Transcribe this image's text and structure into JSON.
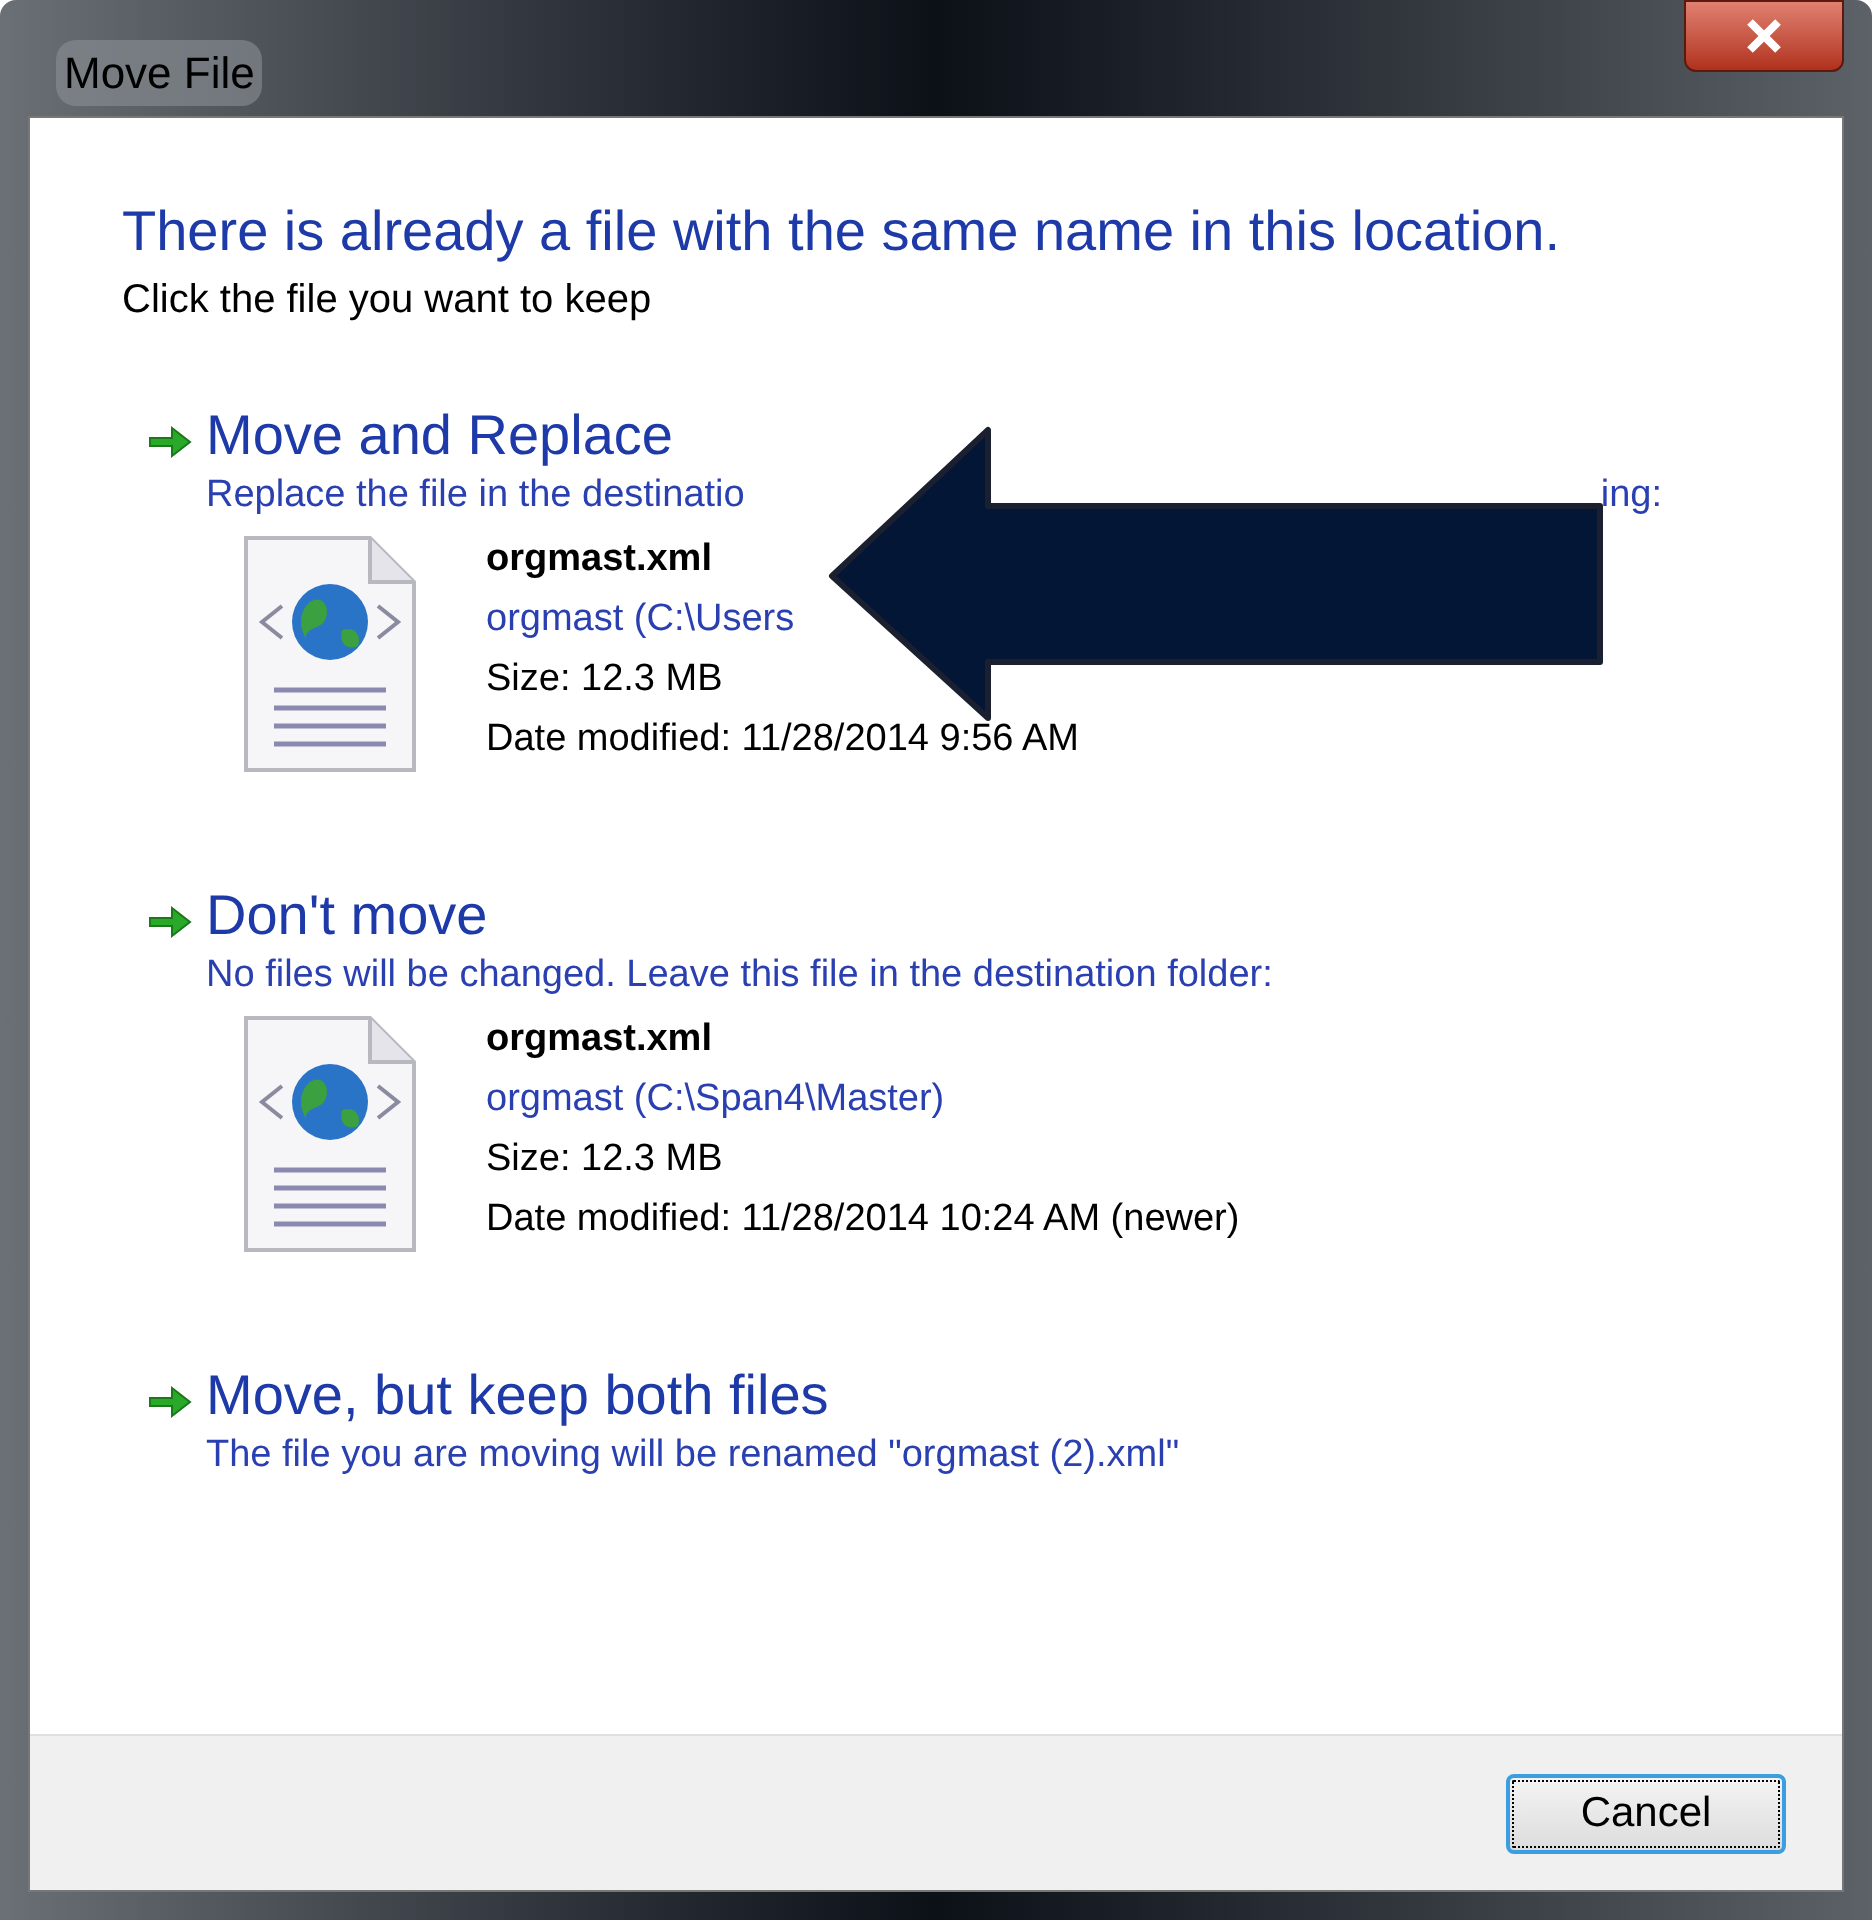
{
  "window": {
    "title": "Move File"
  },
  "heading": "There is already a file with the same name in this location.",
  "instruction": "Click the file you want to keep",
  "options": [
    {
      "title": "Move and Replace",
      "description": [
        "Replace the file in the destinatio",
        "ing:"
      ],
      "file": {
        "name": "orgmast.xml",
        "location": "orgmast (C:\\Users",
        "size": "Size: 12.3 MB",
        "modified": "Date modified: 11/28/2014 9:56 AM"
      }
    },
    {
      "title": "Don't move",
      "description": [
        "No files will be changed. Leave this file in the destination folder:"
      ],
      "file": {
        "name": "orgmast.xml",
        "location": "orgmast (C:\\Span4\\Master)",
        "size": "Size: 12.3 MB",
        "modified": "Date modified: 11/28/2014 10:24 AM (newer)"
      }
    },
    {
      "title": "Move, but keep both files",
      "description": [
        "The file you are moving will be renamed \"orgmast (2).xml\""
      ]
    }
  ],
  "buttons": [
    {
      "label": "Cancel",
      "focused": true
    }
  ],
  "annotation": {
    "kind": "arrow"
  }
}
